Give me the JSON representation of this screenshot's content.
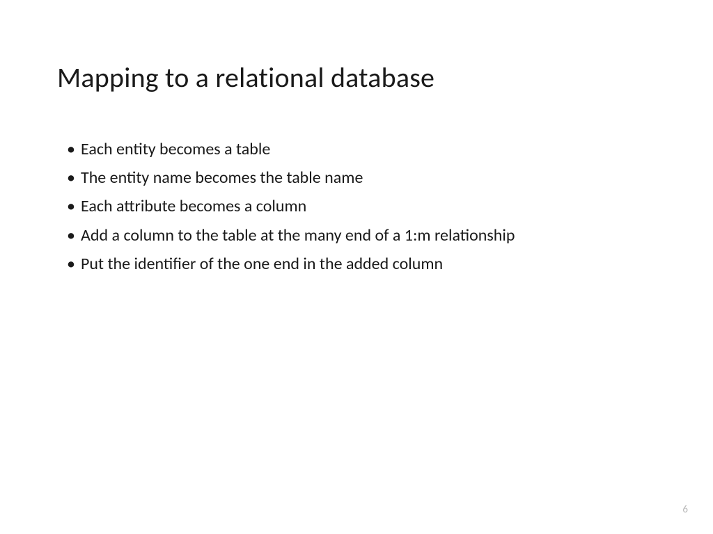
{
  "slide": {
    "title": "Mapping to a relational database",
    "bullets": [
      "Each entity becomes a table",
      "The entity name becomes the table name",
      "Each attribute becomes a column",
      "Add a column to the table at the many end of a 1:m relationship",
      "Put the identifier of the one end in the added column"
    ],
    "page_number": "6"
  }
}
